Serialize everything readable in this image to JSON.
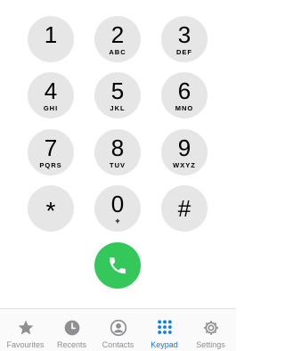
{
  "keypad": {
    "keys": [
      {
        "digit": "1",
        "letters": ""
      },
      {
        "digit": "2",
        "letters": "ABC"
      },
      {
        "digit": "3",
        "letters": "DEF"
      },
      {
        "digit": "4",
        "letters": "GHI"
      },
      {
        "digit": "5",
        "letters": "JKL"
      },
      {
        "digit": "6",
        "letters": "MNO"
      },
      {
        "digit": "7",
        "letters": "PQRS"
      },
      {
        "digit": "8",
        "letters": "TUV"
      },
      {
        "digit": "9",
        "letters": "WXYZ"
      },
      {
        "digit": "*",
        "letters": ""
      },
      {
        "digit": "0",
        "letters": "+"
      },
      {
        "digit": "#",
        "letters": ""
      }
    ],
    "key_color": "#e6e6e6",
    "call_icon": "phone-icon",
    "call_color": "#34c759"
  },
  "tabbar": {
    "active_color": "#0a7aff",
    "inactive_color": "#8e8e93",
    "tabs": [
      {
        "label": "Favourites",
        "icon": "star-icon",
        "active": false
      },
      {
        "label": "Recents",
        "icon": "clock-icon",
        "active": false
      },
      {
        "label": "Contacts",
        "icon": "person-icon",
        "active": false
      },
      {
        "label": "Keypad",
        "icon": "keypad-icon",
        "active": true
      },
      {
        "label": "Settings",
        "icon": "gear-icon",
        "active": false
      }
    ]
  }
}
